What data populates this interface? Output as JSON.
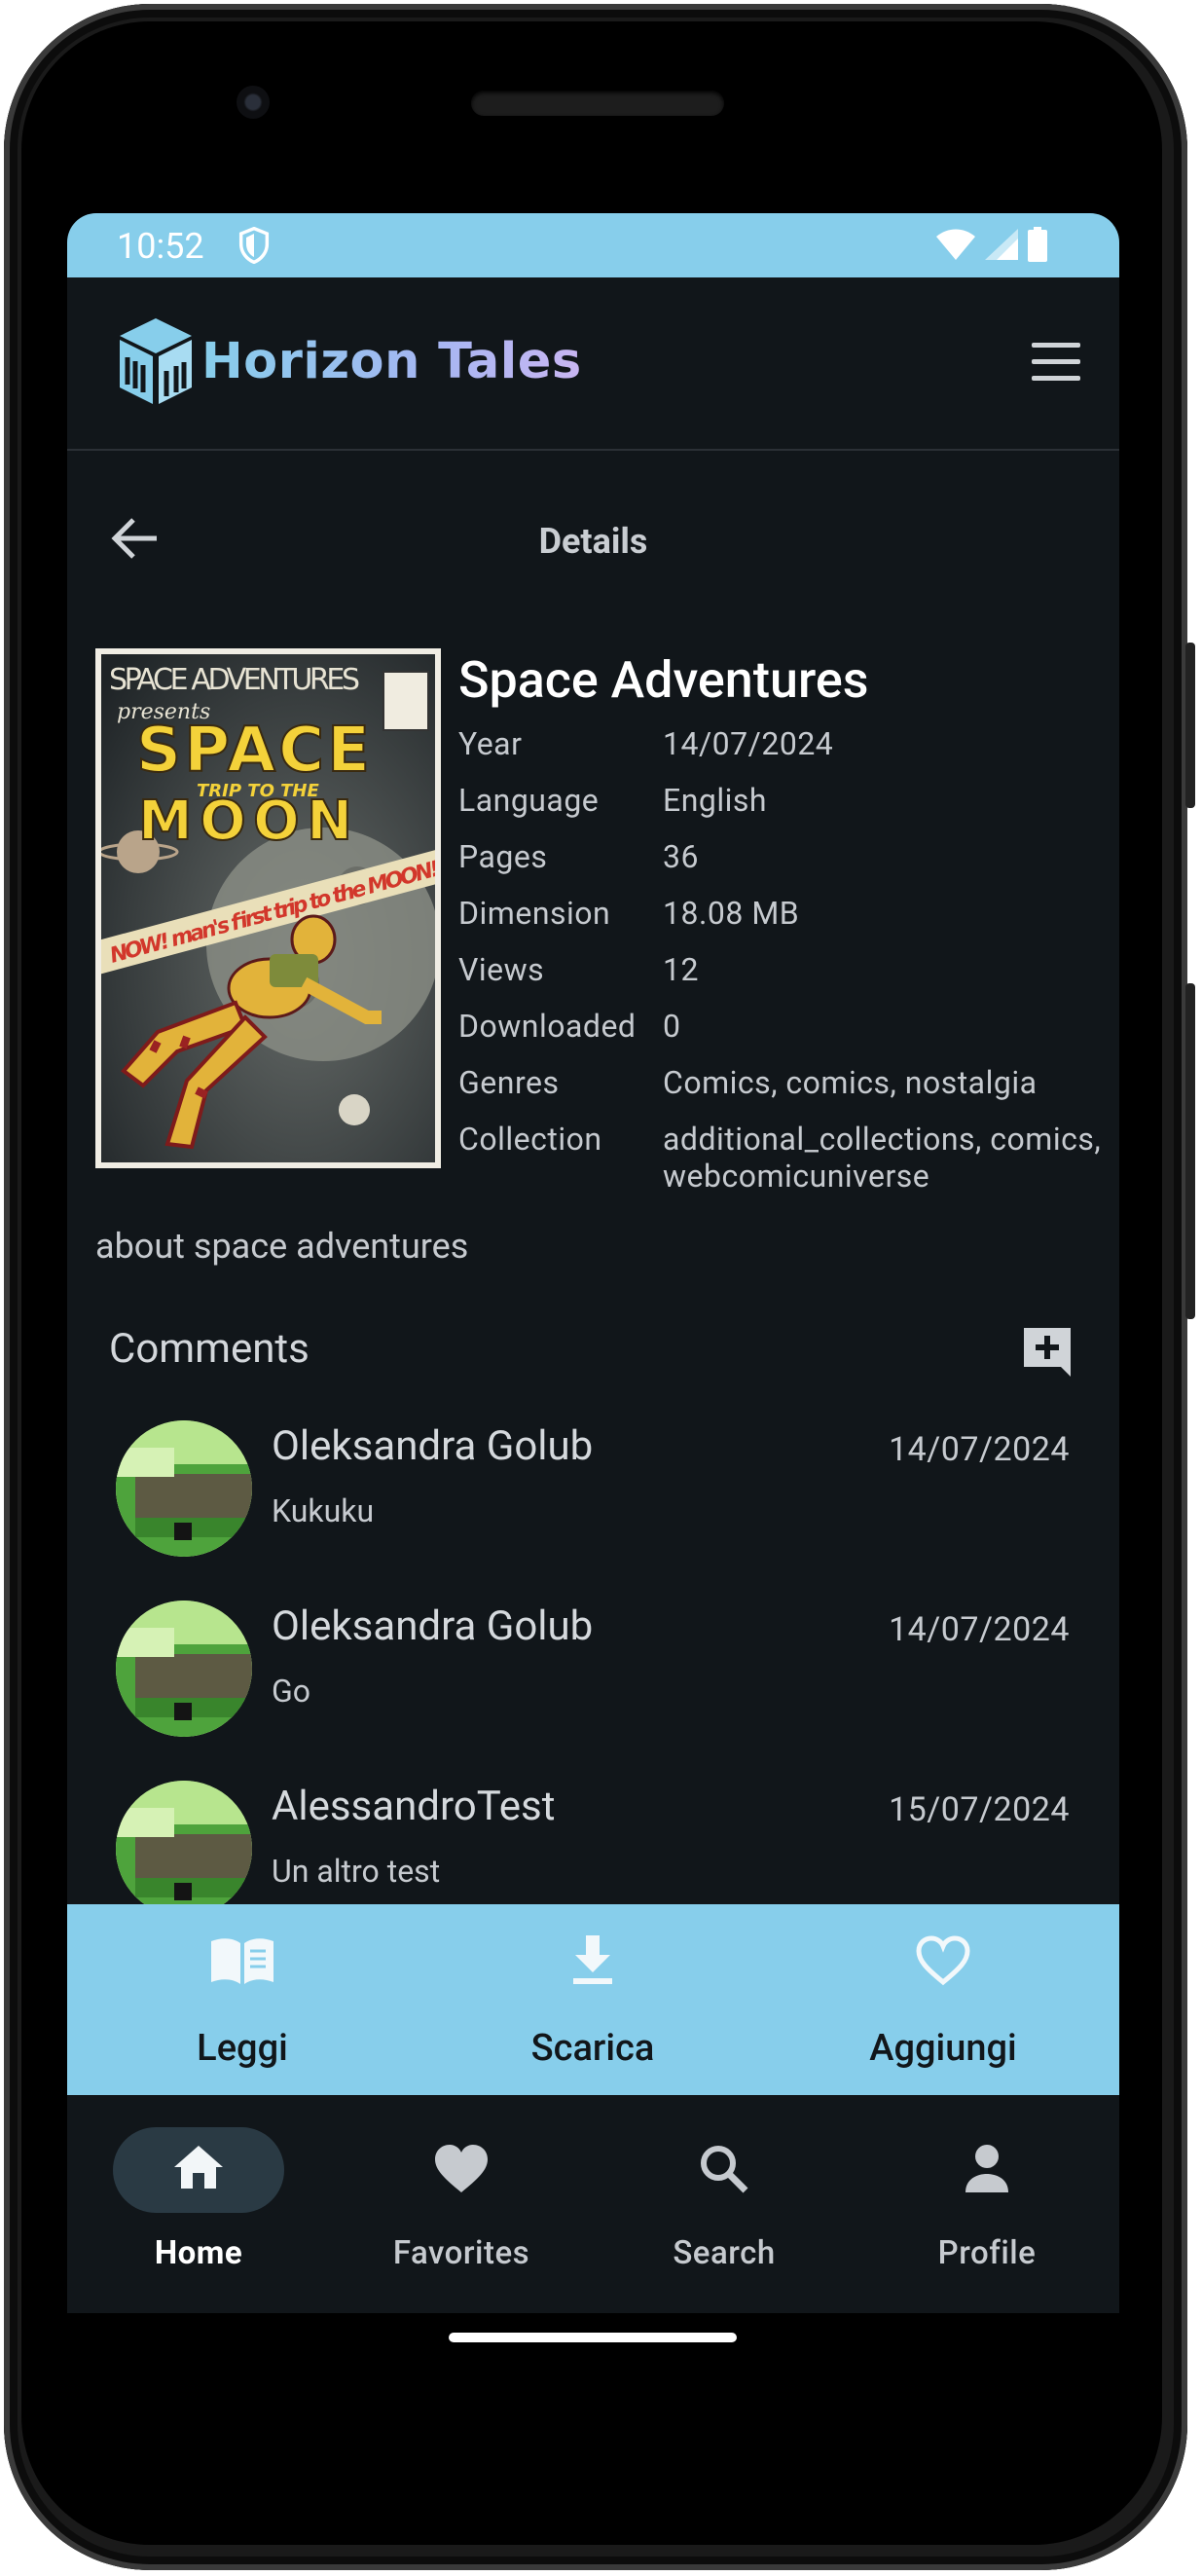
{
  "status_bar": {
    "time": "10:52"
  },
  "app": {
    "name": "Horizon Tales"
  },
  "page": {
    "title": "Details"
  },
  "comic": {
    "title": "Space Adventures",
    "cover": {
      "top_text": "SPACE ADVENTURES",
      "presents": "presents",
      "space": "SPACE",
      "trip": "TRIP TO THE",
      "moon": "MOON",
      "banner": "NOW! man's first trip to the MOON!"
    },
    "meta": [
      {
        "label": "Year",
        "value": "14/07/2024"
      },
      {
        "label": "Language",
        "value": "English"
      },
      {
        "label": "Pages",
        "value": "36"
      },
      {
        "label": "Dimension",
        "value": "18.08 MB"
      },
      {
        "label": "Views",
        "value": "12"
      },
      {
        "label": "Downloaded",
        "value": "0"
      },
      {
        "label": "Genres",
        "value": "Comics, comics, nostalgia"
      },
      {
        "label": "Collection",
        "value": "additional_collections, comics, webcomicuniverse"
      }
    ],
    "description": "about space adventures"
  },
  "comments": {
    "heading": "Comments",
    "items": [
      {
        "author": "Oleksandra Golub",
        "date": "14/07/2024",
        "text": "Kukuku"
      },
      {
        "author": "Oleksandra Golub",
        "date": "14/07/2024",
        "text": "Go"
      },
      {
        "author": "AlessandroTest",
        "date": "15/07/2024",
        "text": "Un altro test"
      }
    ]
  },
  "actions": [
    {
      "label": "Leggi",
      "icon": "book-icon"
    },
    {
      "label": "Scarica",
      "icon": "download-icon"
    },
    {
      "label": "Aggiungi",
      "icon": "heart-outline-icon"
    }
  ],
  "nav": [
    {
      "label": "Home",
      "icon": "home-icon",
      "active": true
    },
    {
      "label": "Favorites",
      "icon": "heart-icon"
    },
    {
      "label": "Search",
      "icon": "search-icon"
    },
    {
      "label": "Profile",
      "icon": "person-icon"
    }
  ],
  "colors": {
    "accent": "#87ceeb",
    "background": "#11161a",
    "text": "#c6cacf"
  }
}
